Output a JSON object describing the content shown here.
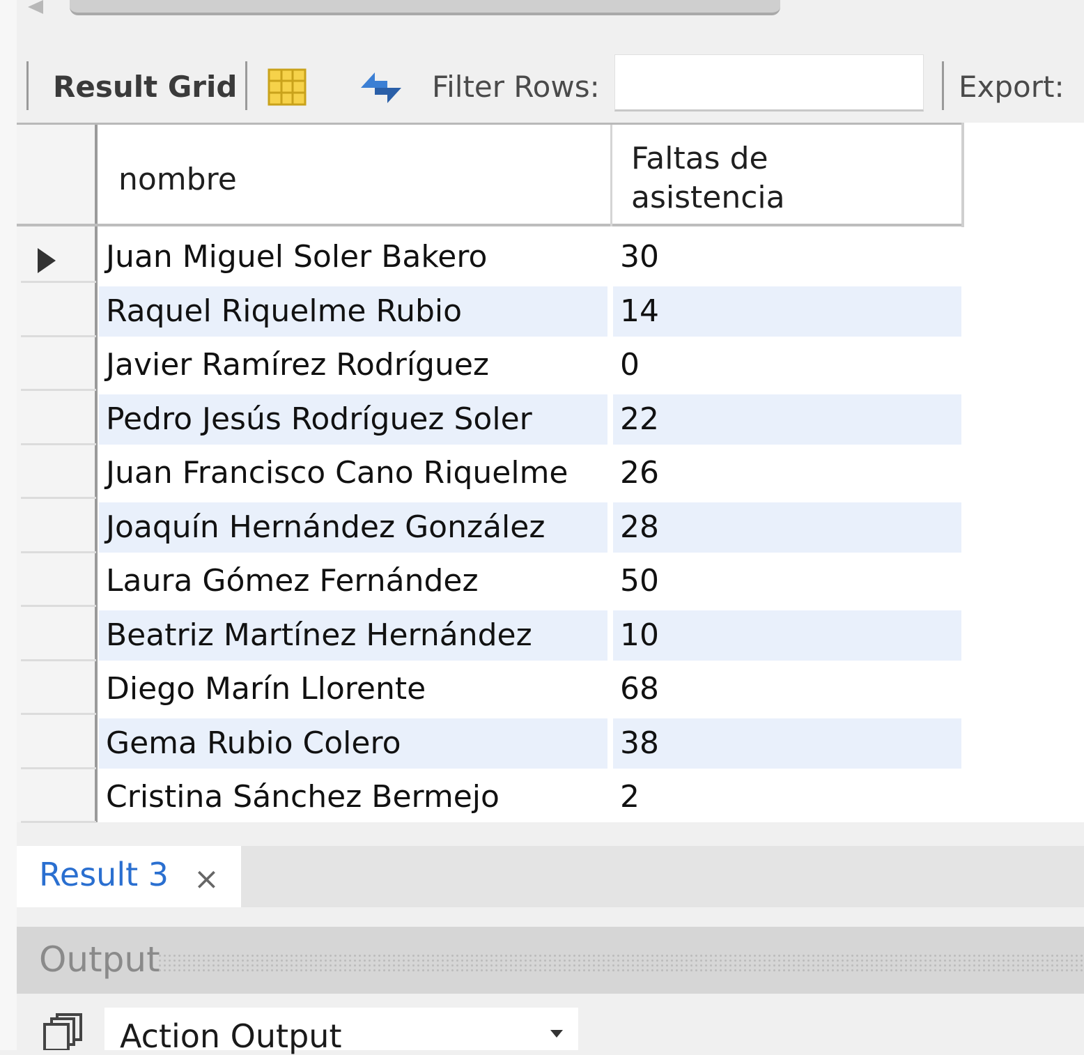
{
  "toolbar": {
    "result_grid_label": "Result Grid",
    "filter_label": "Filter Rows:",
    "filter_value": "",
    "export_label": "Export:"
  },
  "grid": {
    "columns": [
      "nombre",
      "Faltas de asistencia"
    ],
    "column_header_lines": [
      "Faltas de",
      "asistencia"
    ],
    "rows": [
      {
        "nombre": "Juan Miguel Soler Bakero",
        "faltas": "30"
      },
      {
        "nombre": "Raquel Riquelme Rubio",
        "faltas": "14"
      },
      {
        "nombre": "Javier Ramírez Rodríguez",
        "faltas": "0"
      },
      {
        "nombre": "Pedro Jesús Rodríguez Soler",
        "faltas": "22"
      },
      {
        "nombre": "Juan Francisco Cano Riquelme",
        "faltas": "26"
      },
      {
        "nombre": "Joaquín Hernández González",
        "faltas": "28"
      },
      {
        "nombre": "Laura Gómez Fernández",
        "faltas": "50"
      },
      {
        "nombre": "Beatriz Martínez Hernández",
        "faltas": "10"
      },
      {
        "nombre": "Diego Marín Llorente",
        "faltas": "68"
      },
      {
        "nombre": "Gema Rubio Colero",
        "faltas": "38"
      },
      {
        "nombre": "Cristina Sánchez Bermejo",
        "faltas": "2"
      }
    ],
    "selected_row": 0
  },
  "tabs": [
    {
      "label": "Result 3",
      "close": "×",
      "active": true
    }
  ],
  "output": {
    "title": "Output",
    "selector_value": "Action Output"
  },
  "colors": {
    "accent": "#2a6fd0",
    "alt_row": "#e9f0fb",
    "panel": "#f0f0f0"
  },
  "icons": [
    "grid-layout-icon",
    "refresh-icon",
    "copy-icon",
    "dropdown-caret-icon",
    "row-pointer-icon"
  ]
}
